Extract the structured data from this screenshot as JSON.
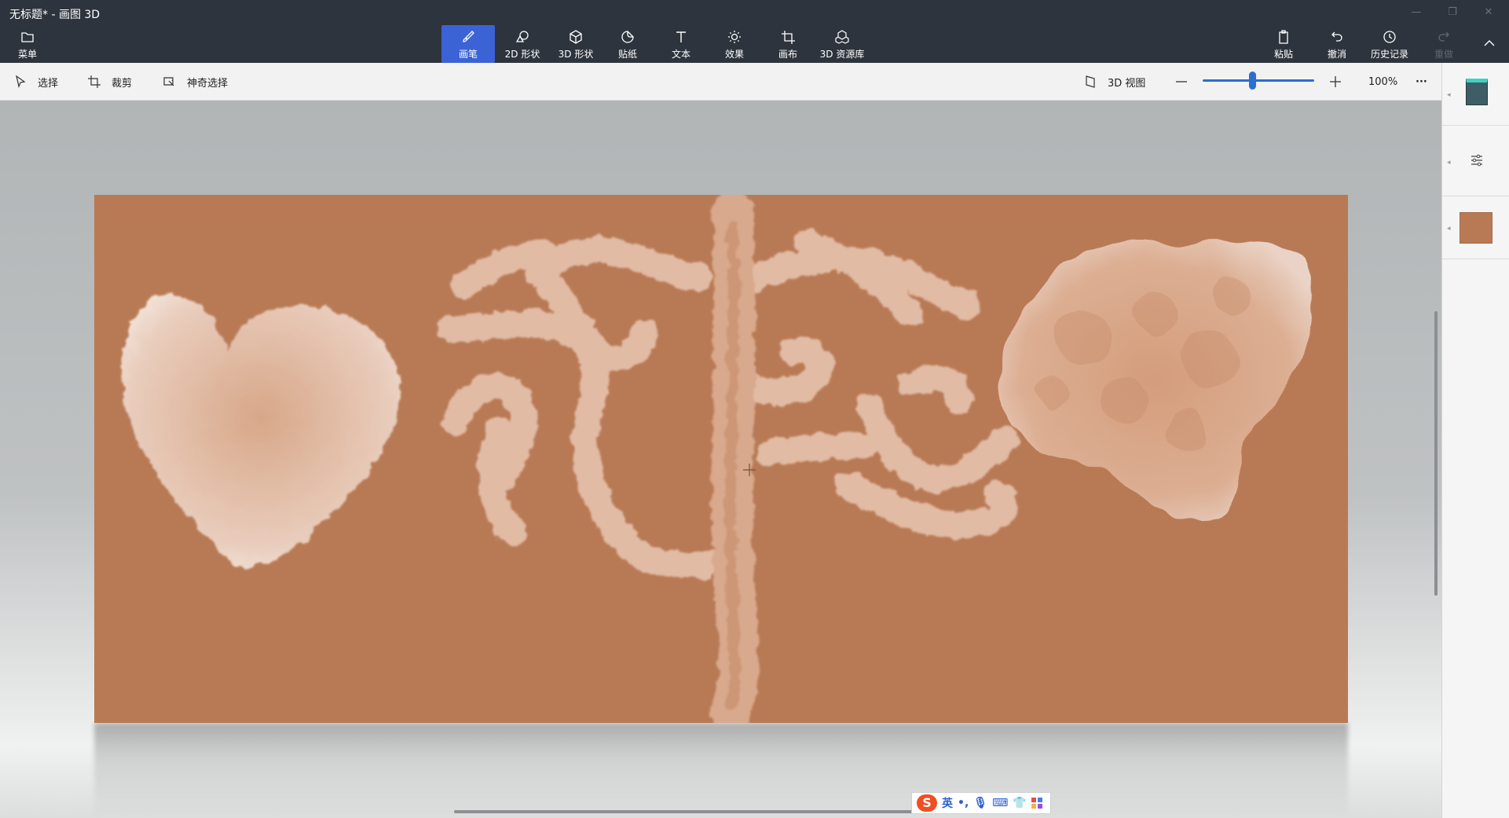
{
  "window": {
    "title": "无标题* - 画图 3D"
  },
  "ribbon": {
    "menu_label": "菜单",
    "tools": [
      {
        "id": "brushes",
        "label": "画笔",
        "icon": "brush-icon",
        "active": true
      },
      {
        "id": "shapes2d",
        "label": "2D 形状",
        "icon": "shapes-2d-icon"
      },
      {
        "id": "shapes3d",
        "label": "3D 形状",
        "icon": "cube-icon"
      },
      {
        "id": "stickers",
        "label": "贴纸",
        "icon": "sticker-icon"
      },
      {
        "id": "text",
        "label": "文本",
        "icon": "text-icon"
      },
      {
        "id": "effects",
        "label": "效果",
        "icon": "sun-icon"
      },
      {
        "id": "canvas",
        "label": "画布",
        "icon": "canvas-icon"
      },
      {
        "id": "library",
        "label": "3D 资源库",
        "icon": "library-icon"
      }
    ],
    "right": [
      {
        "id": "paste",
        "label": "粘贴",
        "icon": "paste-icon"
      },
      {
        "id": "undo",
        "label": "撤消",
        "icon": "undo-icon"
      },
      {
        "id": "history",
        "label": "历史记录",
        "icon": "history-icon"
      },
      {
        "id": "redo",
        "label": "重做",
        "icon": "redo-icon",
        "disabled": true
      }
    ]
  },
  "commandbar": {
    "select_label": "选择",
    "crop_label": "裁剪",
    "magic_select_label": "神奇选择",
    "view3d_label": "3D 视图",
    "zoom_value": "100%",
    "zoom_slider_fraction": 0.45,
    "more_label": "···"
  },
  "canvas": {
    "background_color": "#b87a55",
    "brush_color": "#b87a55"
  },
  "ime": {
    "language": "英",
    "punct": "•,",
    "icons": [
      "mic-icon",
      "keyboard-icon",
      "skin-icon",
      "apps-icon"
    ]
  },
  "colors": {
    "accent": "#3b63d6",
    "titlebar": "#2e343d"
  }
}
